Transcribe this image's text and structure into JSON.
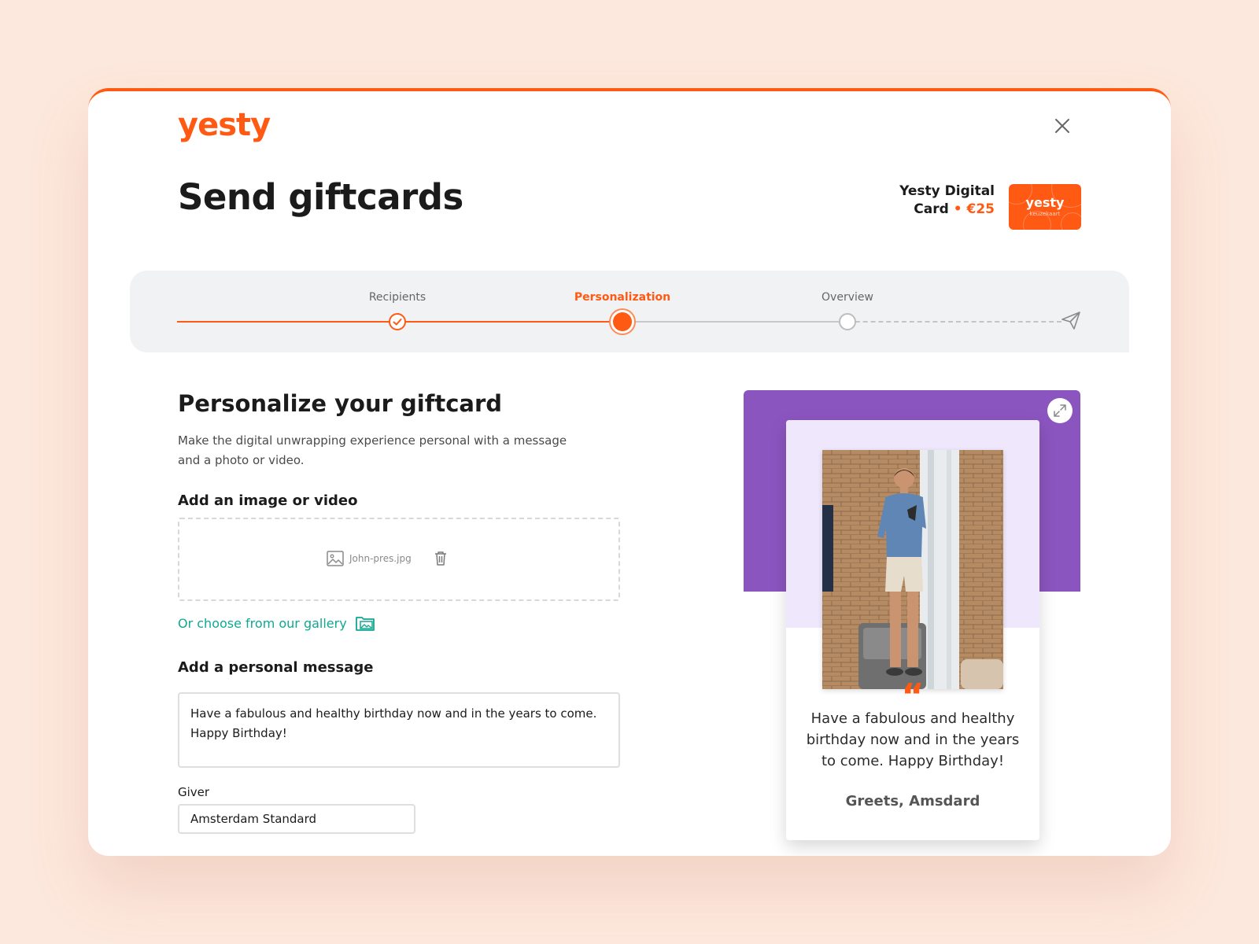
{
  "brand": {
    "logo": "yesty",
    "accent_color": "#ff5a14",
    "purple": "#8b55c0",
    "link_color": "#10a892"
  },
  "header": {
    "title": "Send giftcards",
    "product_name_line1": "Yesty Digital",
    "product_name_line2": "Card",
    "product_separator": "•",
    "product_price": "€25",
    "card_thumb_logo": "yesty",
    "card_thumb_sub": "keuzekaart"
  },
  "stepper": {
    "steps": [
      {
        "label": "Recipients",
        "state": "completed"
      },
      {
        "label": "Personalization",
        "state": "active"
      },
      {
        "label": "Overview",
        "state": "upcoming"
      }
    ],
    "end_icon": "paper-plane-icon"
  },
  "form": {
    "section_title": "Personalize your giftcard",
    "intro_line1": "Make the digital unwrapping experience personal with a message",
    "intro_line2": "and a photo or video.",
    "media_label": "Add an image or video",
    "file_name": "John-pres.jpg",
    "gallery_link": "Or choose from our gallery",
    "message_label": "Add a personal message",
    "message_value": "Have a fabulous and healthy birthday now and in the years to come.\nHappy Birthday!",
    "giver_label": "Giver",
    "giver_value": "Amsterdam Standard"
  },
  "preview": {
    "quote_mark": "“",
    "message_line1": "Have a fabulous and healthy",
    "message_line2": "birthday now and in the years",
    "message_line3": "to come. Happy Birthday!",
    "signature": "Greets, Amsdard"
  }
}
